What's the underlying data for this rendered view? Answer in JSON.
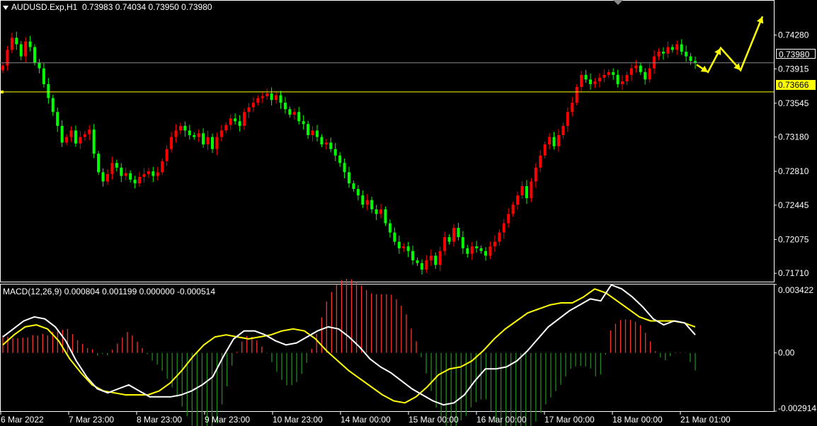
{
  "header": {
    "symbol": "AUDUSD.Exp,H1",
    "ohlc": "0.73983 0.74034 0.73950 0.73980"
  },
  "macd_header": "MACD(12,26,9) 0.000804 0.001199 0.000000 -0.000514",
  "colors": {
    "background": "#000000",
    "bull_candle": "#ff0000",
    "bear_candle": "#00ff00",
    "macd_line": "#ffffff",
    "signal_line": "#ffff00",
    "histogram_pos": "#ff3030",
    "histogram_neg": "#1f8a1f",
    "hline": "#ffff00",
    "arrows": "#ffff00",
    "grid_border": "#ffffff"
  },
  "price_tags": {
    "current": "0.73980",
    "level": "0.73666"
  },
  "chart_data": [
    {
      "type": "candlestick",
      "title": "AUDUSD.Exp,H1",
      "y_ticks": [
        "0.74280",
        "0.73915",
        "0.73545",
        "0.73180",
        "0.72810",
        "0.72445",
        "0.72075",
        "0.71710"
      ],
      "ylim": [
        0.7162,
        0.7465
      ],
      "x_ticks": [
        "6 Mar 2022",
        "7 Mar 23:00",
        "8 Mar 23:00",
        "9 Mar 23:00",
        "10 Mar 23:00",
        "14 Mar 00:00",
        "15 Mar 00:00",
        "16 Mar 00:00",
        "17 Mar 00:00",
        "18 Mar 00:00",
        "21 Mar 01:00"
      ],
      "horizontal_lines": [
        {
          "label": "0.73980",
          "value": 0.7398,
          "color": "#8a8a8a"
        },
        {
          "label": "0.73666",
          "value": 0.73666,
          "color": "#ffff00"
        }
      ],
      "close_series": [
        0.7395,
        0.7412,
        0.7425,
        0.7418,
        0.7405,
        0.7421,
        0.7415,
        0.7398,
        0.7392,
        0.7375,
        0.736,
        0.7345,
        0.733,
        0.7312,
        0.7318,
        0.7325,
        0.7311,
        0.7318,
        0.7321,
        0.7326,
        0.73,
        0.728,
        0.727,
        0.7278,
        0.729,
        0.7285,
        0.7276,
        0.7279,
        0.7272,
        0.7268,
        0.7275,
        0.7278,
        0.7281,
        0.7276,
        0.728,
        0.7292,
        0.7305,
        0.7318,
        0.7325,
        0.733,
        0.7325,
        0.732,
        0.7318,
        0.7322,
        0.731,
        0.7318,
        0.7305,
        0.7318,
        0.7325,
        0.7331,
        0.7338,
        0.7335,
        0.733,
        0.7345,
        0.735,
        0.7355,
        0.736,
        0.7362,
        0.7365,
        0.7358,
        0.7363,
        0.7355,
        0.7348,
        0.7342,
        0.7345,
        0.7335,
        0.7332,
        0.732,
        0.7325,
        0.7318,
        0.731,
        0.7312,
        0.7305,
        0.7298,
        0.729,
        0.728,
        0.7268,
        0.7262,
        0.7255,
        0.7245,
        0.725,
        0.724,
        0.7235,
        0.724,
        0.7225,
        0.7215,
        0.7205,
        0.7198,
        0.72,
        0.7195,
        0.7185,
        0.7182,
        0.7175,
        0.7185,
        0.719,
        0.718,
        0.7195,
        0.721,
        0.7205,
        0.722,
        0.721,
        0.7198,
        0.7192,
        0.72,
        0.7198,
        0.7195,
        0.719,
        0.72,
        0.7205,
        0.7215,
        0.7225,
        0.7235,
        0.7245,
        0.7255,
        0.7265,
        0.7252,
        0.727,
        0.7285,
        0.7298,
        0.731,
        0.7318,
        0.7308,
        0.732,
        0.733,
        0.7345,
        0.7355,
        0.7372,
        0.7385,
        0.738,
        0.7375,
        0.7378,
        0.7382,
        0.7385,
        0.7388,
        0.7385,
        0.7375,
        0.7378,
        0.7385,
        0.7392,
        0.7395,
        0.7388,
        0.738,
        0.7392,
        0.7405,
        0.741,
        0.7408,
        0.7415,
        0.7412,
        0.7418,
        0.741,
        0.7405,
        0.74,
        0.7398
      ],
      "forecast_arrows": "zigzag up"
    },
    {
      "type": "line",
      "title": "MACD(12,26,9)",
      "series_values": [
        "0.000804",
        "0.001199",
        "0.000000",
        "-0.000514"
      ],
      "y_ticks": [
        "0.003422",
        "0.00",
        "-0.002914"
      ],
      "ylim": [
        -0.002914,
        0.003422
      ],
      "macd": [
        0.0008,
        0.0012,
        0.0016,
        0.0018,
        0.0017,
        0.0013,
        0.0006,
        -0.0004,
        -0.0012,
        -0.0018,
        -0.002,
        -0.0018,
        -0.0016,
        -0.0019,
        -0.0022,
        -0.0022,
        -0.0022,
        -0.0021,
        -0.0019,
        -0.0016,
        -0.0012,
        -0.0002,
        0.0007,
        0.0011,
        0.0011,
        0.0009,
        0.0006,
        0.0004,
        0.0005,
        0.0008,
        0.0011,
        0.0013,
        0.0012,
        0.0008,
        0.0003,
        -0.0003,
        -0.0007,
        -0.001,
        -0.0014,
        -0.0018,
        -0.0021,
        -0.0024,
        -0.0026,
        -0.0025,
        -0.0021,
        -0.0014,
        -0.0008,
        -0.0008,
        -0.0007,
        -0.0004,
        0.0001,
        0.0007,
        0.0013,
        0.0017,
        0.0021,
        0.0024,
        0.0027,
        0.0026,
        0.0034,
        0.0032,
        0.0028,
        0.0023,
        0.0017,
        0.0014,
        0.0016,
        0.0015,
        0.0009
      ],
      "signal": [
        0.0004,
        0.0009,
        0.0013,
        0.0014,
        0.0012,
        0.0006,
        -0.0003,
        -0.001,
        -0.0016,
        -0.0019,
        -0.002,
        -0.0021,
        -0.0021,
        -0.0021,
        -0.0019,
        -0.0015,
        -0.0009,
        -0.0002,
        0.0004,
        0.0008,
        0.0009,
        0.0008,
        0.0007,
        0.0008,
        0.0009,
        0.0011,
        0.0012,
        0.0011,
        0.0007,
        0.0001,
        -0.0004,
        -0.0009,
        -0.0013,
        -0.0017,
        -0.0021,
        -0.0024,
        -0.0025,
        -0.0022,
        -0.0017,
        -0.0011,
        -0.0008,
        -0.0007,
        -0.0004,
        0.0001,
        0.0007,
        0.0012,
        0.0016,
        0.002,
        0.0022,
        0.0024,
        0.0025,
        0.0025,
        0.0028,
        0.0032,
        0.003,
        0.0026,
        0.0022,
        0.0018,
        0.0016,
        0.0016,
        0.0016,
        0.0015,
        0.0013
      ]
    }
  ]
}
